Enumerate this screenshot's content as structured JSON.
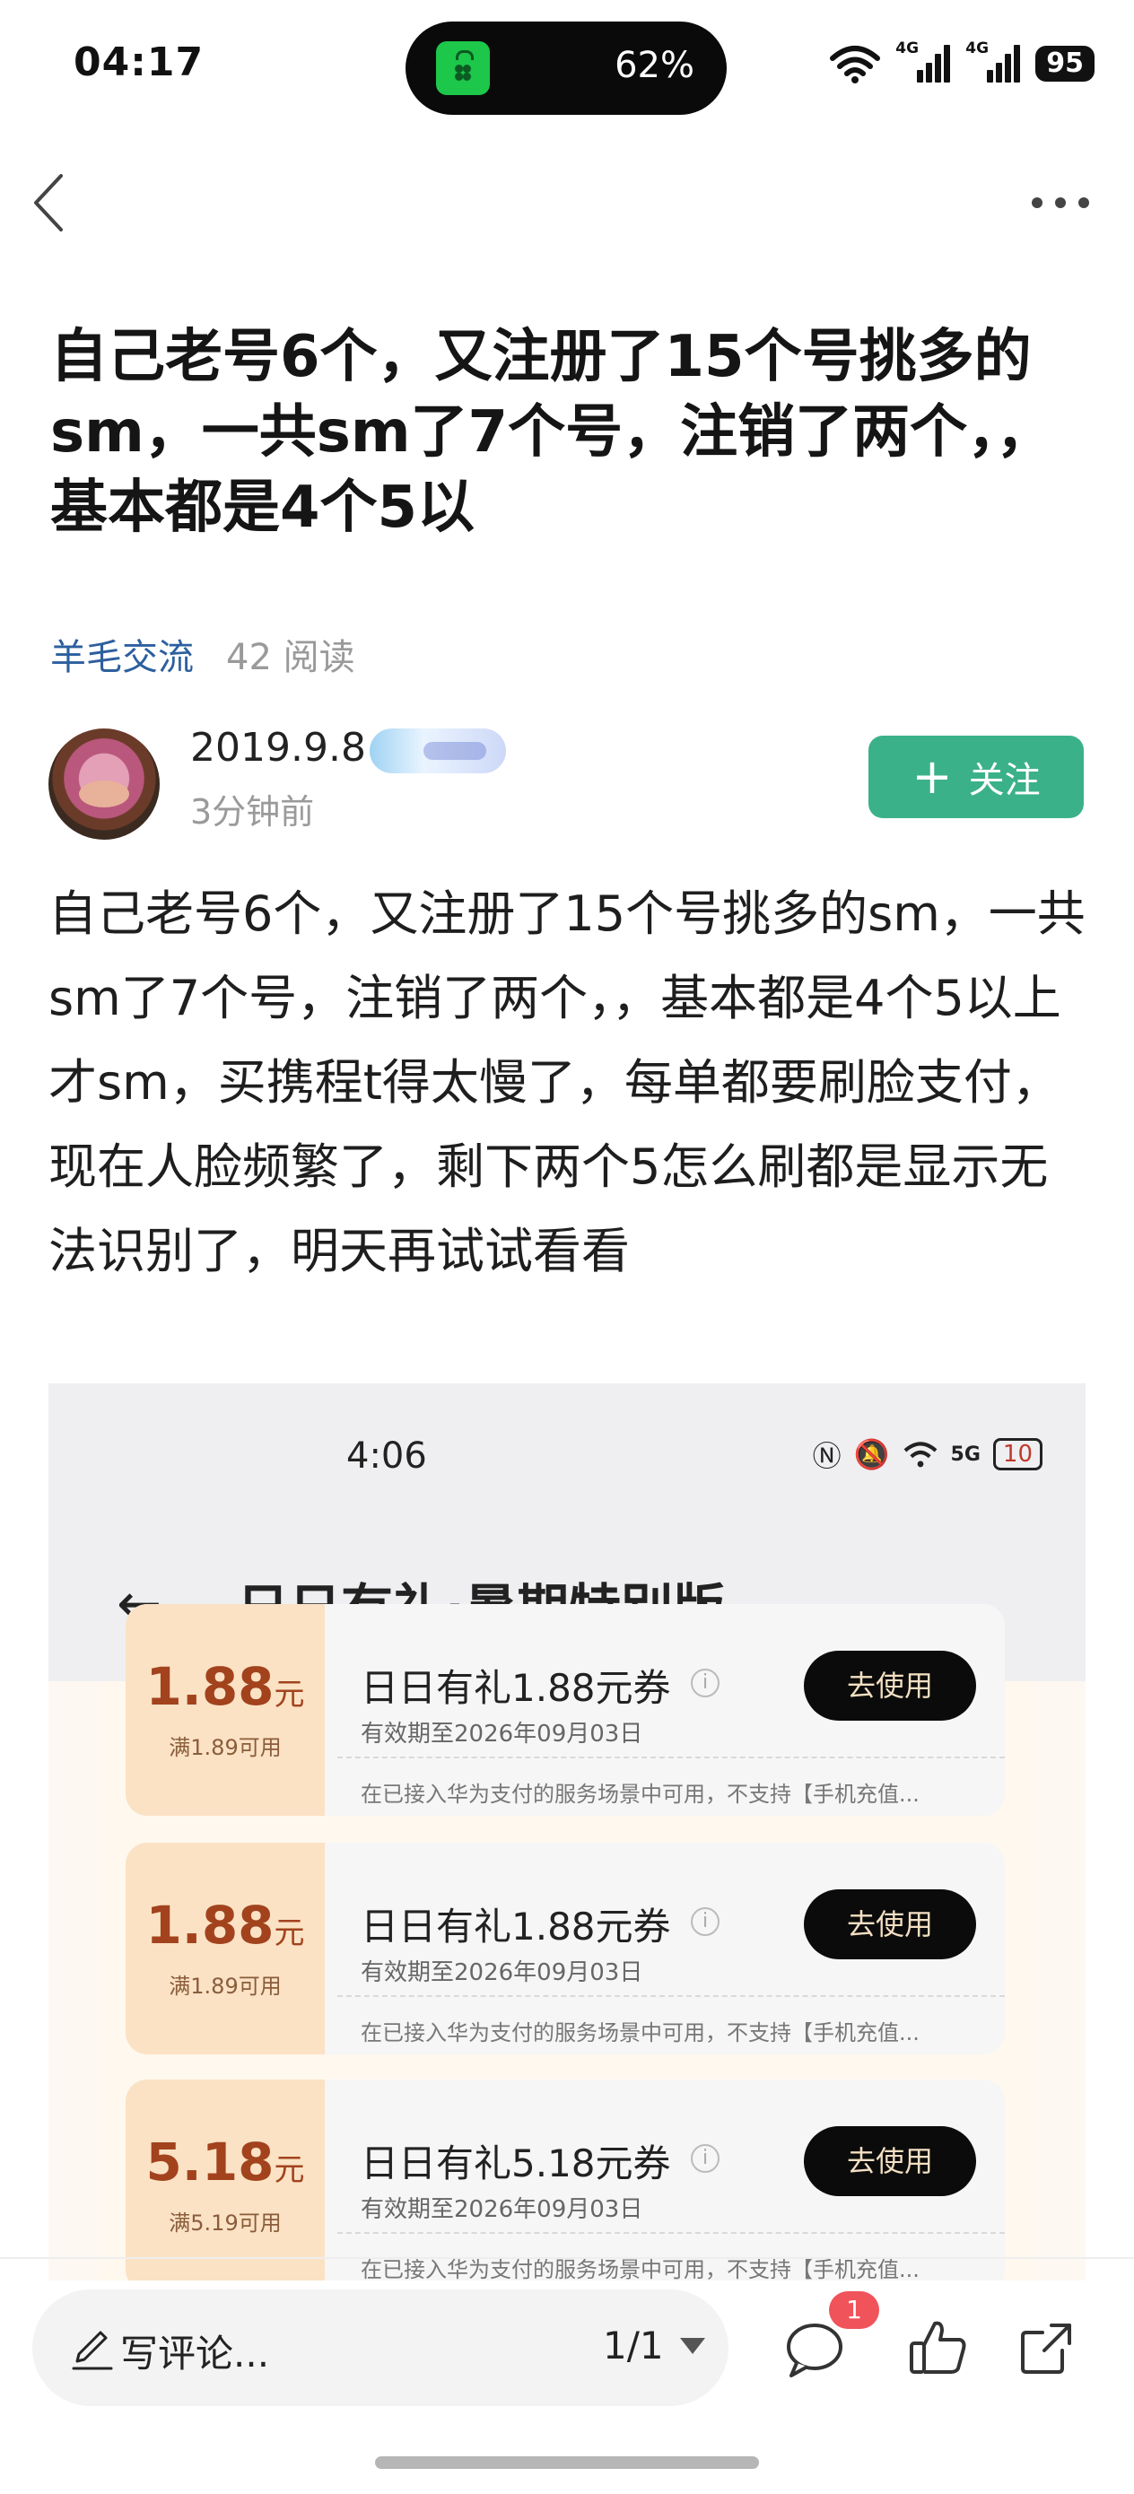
{
  "status_bar": {
    "time": "04:17",
    "island_battery": "62%",
    "signal_label_1": "4G",
    "signal_label_2": "4G",
    "battery": "95"
  },
  "post": {
    "title": "自己老号6个，又注册了15个号挑多的sm，一共sm了7个号，注销了两个，，基本都是4个5以",
    "category": "羊毛交流",
    "read_count": "42 阅读",
    "author": {
      "name": "2019.9.8",
      "time": "3分钟前"
    },
    "follow_label": "关注",
    "body": "自己老号6个，又注册了15个号挑多的sm，一共sm了7个号，注销了两个，，基本都是4个5以上才sm，买携程t得太慢了，每单都要刷脸支付，现在人脸频繁了，剩下两个5怎么刷都是显示无法识别了，明天再试试看看"
  },
  "embedded_screenshot": {
    "time": "4:06",
    "status_net": "5G",
    "battery": "10",
    "title": "日日有礼·暑期特别版",
    "coupons": [
      {
        "amount": "1.88",
        "unit": "元",
        "condition": "满1.89可用",
        "name": "日日有礼1.88元券",
        "validity": "有效期至2026年09月03日",
        "description": "在已接入华为支付的服务场景中可用，不支持【手机充值...",
        "button": "去使用"
      },
      {
        "amount": "1.88",
        "unit": "元",
        "condition": "满1.89可用",
        "name": "日日有礼1.88元券",
        "validity": "有效期至2026年09月03日",
        "description": "在已接入华为支付的服务场景中可用，不支持【手机充值...",
        "button": "去使用"
      },
      {
        "amount": "5.18",
        "unit": "元",
        "condition": "满5.19可用",
        "name": "日日有礼5.18元券",
        "validity": "有效期至2026年09月03日",
        "description": "在已接入华为支付的服务场景中可用，不支持【手机充值...",
        "button": "去使用"
      }
    ]
  },
  "bottom_bar": {
    "comment_placeholder": "写评论...",
    "page_indicator": "1/1",
    "comment_count": "1"
  },
  "colors": {
    "follow_green": "#3bb18a",
    "category_blue": "#2c5f9e",
    "badge_red": "#f0535a"
  }
}
